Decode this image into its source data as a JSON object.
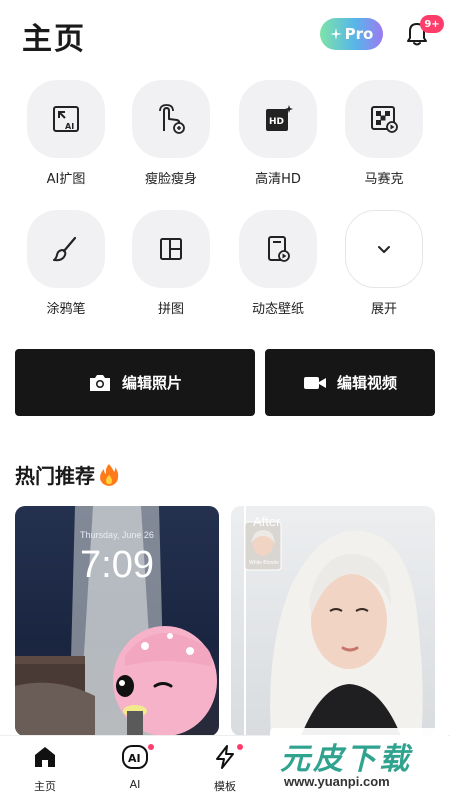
{
  "header": {
    "title": "主页",
    "pro_label": "Pro",
    "notif_count": "9+"
  },
  "tools": [
    {
      "label": "AI扩图",
      "icon": "ai-expand-icon"
    },
    {
      "label": "瘦脸瘦身",
      "icon": "slim-touch-icon"
    },
    {
      "label": "高清HD",
      "icon": "hd-icon"
    },
    {
      "label": "马赛克",
      "icon": "mosaic-icon"
    },
    {
      "label": "涂鸦笔",
      "icon": "brush-icon"
    },
    {
      "label": "拼图",
      "icon": "collage-icon"
    },
    {
      "label": "动态壁纸",
      "icon": "live-wallpaper-icon"
    },
    {
      "label": "展开",
      "icon": "chevron-down-icon"
    }
  ],
  "actions": {
    "edit_photo": "编辑照片",
    "edit_video": "编辑视频"
  },
  "trending": {
    "title": "热门推荐",
    "lockscreen_date": "Thursday, June 26",
    "lockscreen_time": "7:09",
    "after_label": "After",
    "thumb_caption": "White Blonde"
  },
  "tabbar": [
    {
      "label": "主页",
      "icon": "home-icon"
    },
    {
      "label": "AI",
      "icon": "ai-icon"
    },
    {
      "label": "模板",
      "icon": "lightning-icon"
    },
    {
      "label": "",
      "icon": ""
    },
    {
      "label": "",
      "icon": ""
    }
  ],
  "watermark": {
    "logo": "元皮下载",
    "url": "www.yuanpi.com"
  },
  "colors": {
    "accent_red": "#ff3d6a",
    "button_dark": "#161616",
    "pro_gradient_start": "#7de3a9",
    "pro_gradient_end": "#9a7bf2"
  }
}
